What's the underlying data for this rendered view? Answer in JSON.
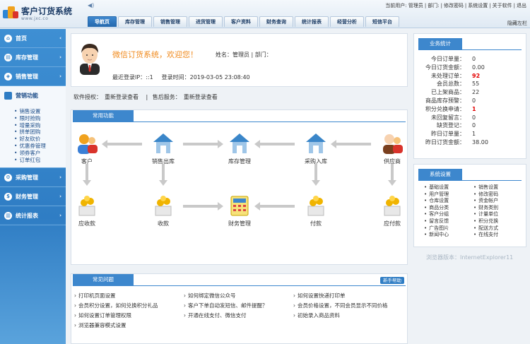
{
  "app": {
    "title": "客户订货系统",
    "subtitle": "www.jxc.co"
  },
  "toplinks": [
    "当前用户: 管理员",
    "|",
    "部门:",
    "|",
    "修改密码",
    "|",
    "系统设置",
    "|",
    "关于软件",
    "|",
    "退出"
  ],
  "nav": [
    "导航页",
    "库存管理",
    "销售管理",
    "进货管理",
    "客户资料",
    "财务查询",
    "统计报表",
    "经营分析",
    "短信平台"
  ],
  "hide_left": "隐藏左栏",
  "sidebar": {
    "items": [
      {
        "label": "首页",
        "arrow": "‹"
      },
      {
        "label": "库存管理",
        "arrow": "›"
      },
      {
        "label": "销售管理",
        "arrow": "›"
      }
    ],
    "active": {
      "label": "营销功能",
      "subitems": [
        "销售设置",
        "限时抢购",
        "增量采购",
        "拼单团购",
        "好友砍价",
        "优惠券管理",
        "领券客户",
        "订单红包"
      ]
    },
    "items2": [
      {
        "label": "采购管理",
        "arrow": "›"
      },
      {
        "label": "财务管理",
        "arrow": "›"
      },
      {
        "label": "统计报表",
        "arrow": "›"
      }
    ]
  },
  "welcome": {
    "greeting": "微信订货系统，欢迎您！",
    "name_label": "姓名：",
    "name": "管理员",
    "dept_label": "部门：",
    "ip": "最近登录IP：::1",
    "time": "登录时间：2019-03-05 23:08:40"
  },
  "license": {
    "label1": "软件授权：",
    "val1": "重新登录查看",
    "sep": "|",
    "label2": "售后服务：",
    "val2": "重新登录查看"
  },
  "flow": {
    "title": "常用功能",
    "nodes": [
      "客户",
      "销售出库",
      "库存管理",
      "采购入库",
      "供应商",
      "应收款",
      "收款",
      "财务管理",
      "付款",
      "应付款"
    ]
  },
  "faq": {
    "title": "常见问题",
    "help": "新手帮助",
    "items": [
      [
        "打印机页面设置",
        "如何绑定微信公众号",
        "如何设置快递打印单"
      ],
      [
        "会员积分设置，如何兑换积分礼品",
        "客户下单自动发短信、邮件提醒？",
        "会员价格设置，不同会员显示不同价格"
      ],
      [
        "如何设置订单管理权限",
        "开通在线支付、微信支付",
        "初始录入商品资料"
      ],
      [
        "浏览器兼容模式设置",
        "",
        ""
      ]
    ]
  },
  "stats": {
    "title": "业务统计",
    "rows": [
      {
        "k": "今日订单量：",
        "v": "0",
        "red": false
      },
      {
        "k": "今日订货金额：",
        "v": "0.00",
        "red": false
      },
      {
        "k": "未处理订单：",
        "v": "92",
        "red": true
      },
      {
        "k": "会员总数：",
        "v": "55",
        "red": false
      },
      {
        "k": "已上架商品：",
        "v": "22",
        "red": false
      },
      {
        "k": "商品库存预警：",
        "v": "0",
        "red": false
      },
      {
        "k": "积分兑换申请：",
        "v": "1",
        "red": true
      },
      {
        "k": "未回复留言：",
        "v": "0",
        "red": false
      },
      {
        "k": "缺货登记：",
        "v": "0",
        "red": false
      },
      {
        "k": "昨日订单量：",
        "v": "1",
        "red": false
      },
      {
        "k": "昨日订货金额：",
        "v": "38.00",
        "red": false
      }
    ]
  },
  "settings": {
    "title": "系统设置",
    "items": [
      "基础设置",
      "销售设置",
      "用户管理",
      "修改密码",
      "仓库设置",
      "资金帐户",
      "商品分类",
      "财务类别",
      "客户分组",
      "计量单位",
      "留言反馈",
      "积分兑换",
      "广告图片",
      "配送方式",
      "新闻中心",
      "在线支付"
    ]
  },
  "browser": "浏览器版本：InternetExplorer11"
}
